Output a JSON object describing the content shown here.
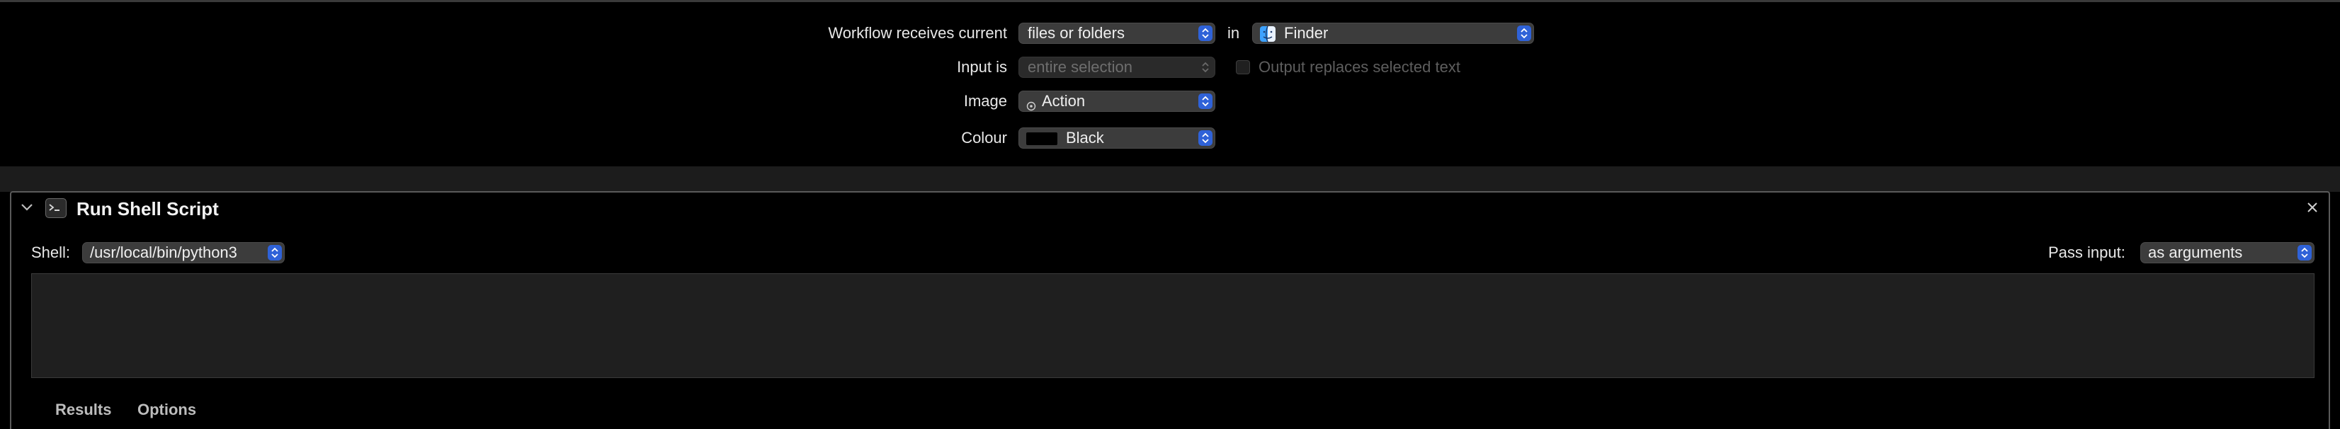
{
  "workflow": {
    "receives_label": "Workflow receives current",
    "receives_value": "files or folders",
    "in_label": "in",
    "app_value": "Finder",
    "input_is_label": "Input is",
    "input_is_value": "entire selection",
    "output_replaces_label": "Output replaces selected text",
    "output_replaces_checked": false,
    "image_label": "Image",
    "image_value": "Action",
    "colour_label": "Colour",
    "colour_value": "Black"
  },
  "action": {
    "title": "Run Shell Script",
    "shell_label": "Shell:",
    "shell_value": "/usr/local/bin/python3",
    "pass_input_label": "Pass input:",
    "pass_input_value": "as arguments",
    "script_text": "",
    "tabs": [
      {
        "label": "Results"
      },
      {
        "label": "Options"
      }
    ]
  },
  "icons": {
    "collapse": "chevron-down-icon",
    "terminal": "terminal-icon",
    "close": "close-icon",
    "finder": "finder-icon",
    "image_action": "action-gear-icon"
  },
  "colors": {
    "accent": "#2f62d8",
    "background": "#000000",
    "panel_gap": "#1c1c1c",
    "script_area": "#1f1f1f"
  }
}
